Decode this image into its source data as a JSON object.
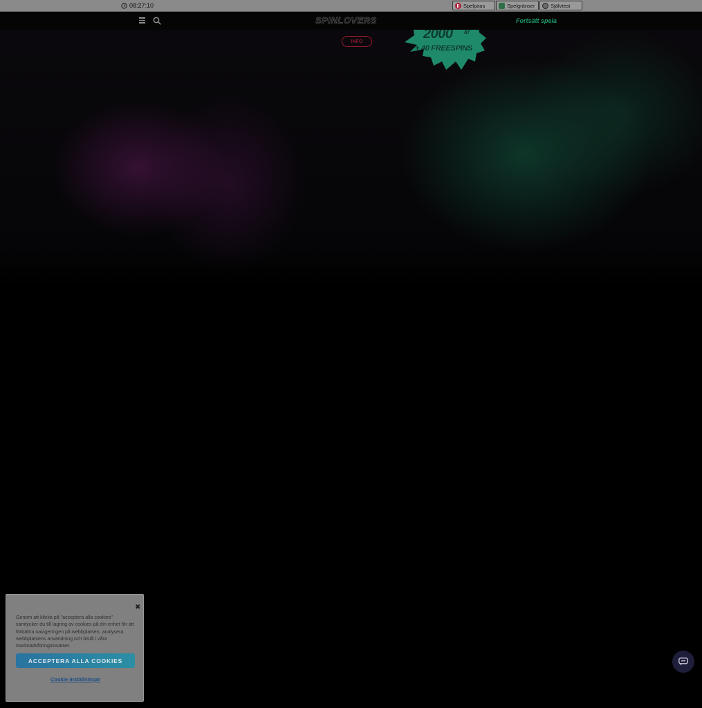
{
  "topbar": {
    "clock": "08:27:10",
    "rg_buttons": [
      {
        "label": "Spelpaus",
        "icon": "pause-icon"
      },
      {
        "label": "Spelgränser",
        "icon": "limits-icon"
      },
      {
        "label": "Självtest",
        "icon": "selftest-icon"
      }
    ]
  },
  "navbar": {
    "logo": "SPINLOVERS",
    "continue_label": "Fortsätt spela",
    "menu_icon": "hamburger-menu-icon",
    "search_icon": "search-icon"
  },
  "hero": {
    "info_label": "INFO",
    "badge": {
      "amount": "2000",
      "unit": "kr",
      "freespins": "+ 40 FREESPINS"
    }
  },
  "cookie_banner": {
    "text": "Genom att klicka på \"acceptera alla cookies\" samtycker du till lagring av cookies på din enhet för att förbättra navigeringen på webbplatsen, analysera webbplatsens användning och bistå i våra marknadsföringsinsatser.",
    "accept_label": "ACCEPTERA ALLA COOKIES",
    "settings_label": "Cookie-inställningar",
    "close_icon": "close-icon"
  },
  "chat": {
    "icon": "chat-icon"
  },
  "colors": {
    "accent_green": "#1d9a6a",
    "info_red": "#a01a2e",
    "accept_blue": "#2a73a0"
  }
}
